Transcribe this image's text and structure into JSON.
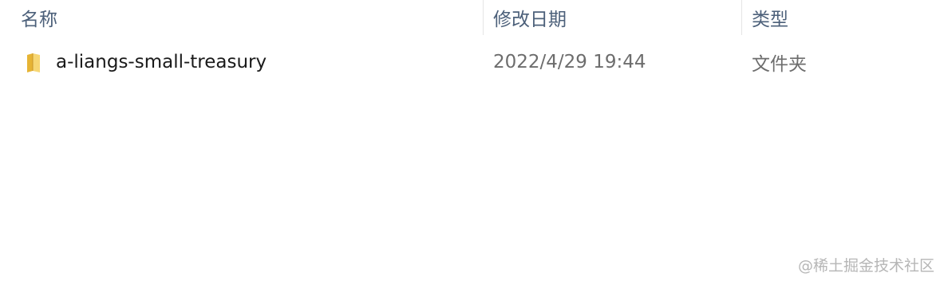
{
  "columns": {
    "name": "名称",
    "modified": "修改日期",
    "type": "类型"
  },
  "files": [
    {
      "name": "a-liangs-small-treasury",
      "modified": "2022/4/29 19:44",
      "type": "文件夹",
      "icon": "folder-icon"
    }
  ],
  "watermark": "@稀土掘金技术社区",
  "colors": {
    "header_text": "#4c607a",
    "name_text": "#1a1a1a",
    "meta_text": "#6d6d6d",
    "folder": "#f2c94c"
  }
}
